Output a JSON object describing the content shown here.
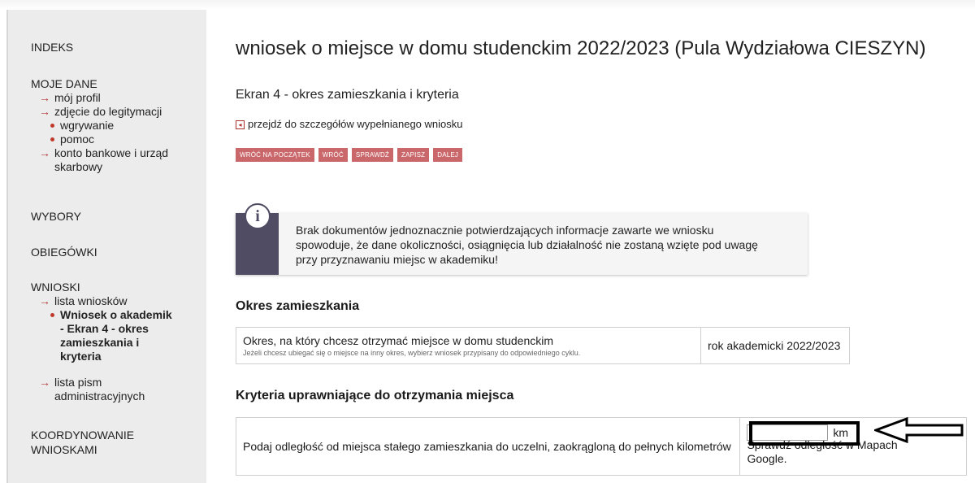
{
  "sidebar": {
    "indeks": "INDEKS",
    "moje_dane": "MOJE DANE",
    "moj_profil": "mój profil",
    "zdjecie": "zdjęcie do legitymacji",
    "wgrywanie": "wgrywanie",
    "pomoc": "pomoc",
    "konto_1": "konto bankowe i urząd",
    "konto_2": "skarbowy",
    "wybory": "WYBORY",
    "obiegowki": "OBIEGÓWKI",
    "wnioski": "WNIOSKI",
    "lista_wnioskow": "lista wniosków",
    "wniosek_1": "Wniosek o akademik",
    "wniosek_2": "- Ekran 4 - okres",
    "wniosek_3": "zamieszkania i",
    "wniosek_4": "kryteria",
    "lista_pism_1": "lista pism",
    "lista_pism_2": "administracyjnych",
    "koord_1": "KOORDYNOWANIE",
    "koord_2": "WNIOSKAMI"
  },
  "main": {
    "title": "wniosek o miejsce w domu studenckim 2022/2023 (Pula Wydziałowa CIESZYN)",
    "subtitle": "Ekran 4 - okres zamieszkania i kryteria",
    "back_link": "przejdź do szczegółów wypełnianego wniosku",
    "buttons": {
      "start": "WRÓĆ NA POCZĄTEK",
      "back": "WRÓĆ",
      "check": "SPRAWDŹ",
      "save": "ZAPISZ",
      "next": "DALEJ"
    },
    "notice": {
      "icon_glyph": "i",
      "line1": "Brak dokumentów jednoznacznie potwierdzających informacje zawarte we wniosku",
      "line2": "spowoduje, że dane okoliczności, osiągnięcia lub działalność nie zostaną wzięte pod uwagę",
      "line3": "przy przyznawaniu miejsc w akademiku!"
    },
    "section1": {
      "heading": "Okres zamieszkania",
      "question": "Okres, na który chcesz otrzymać miejsce w domu studenckim",
      "hint": "Jeżeli chcesz ubiegać się o miejsce na inny okres, wybierz wniosek przypisany do odpowiedniego cyklu.",
      "value": "rok akademicki 2022/2023"
    },
    "section2": {
      "heading": "Kryteria uprawniające do otrzymania miejsca",
      "question": "Podaj odległość od miejsca stałego zamieszkania do uczelni, zaokrągloną do pełnych kilometrów",
      "input_value": "",
      "unit": "km",
      "help_1": "Sprawdź odległość w Mapach",
      "help_2": "Google."
    }
  },
  "colors": {
    "button_bg": "#c9676b",
    "notice_bar": "#4f4c63",
    "sidebar_bg": "#ececec",
    "accent_red": "#c0392b"
  },
  "icons": [
    "arrow-right-icon",
    "bullet-icon",
    "back-arrow-icon",
    "info-icon",
    "pointer-arrow-icon"
  ]
}
